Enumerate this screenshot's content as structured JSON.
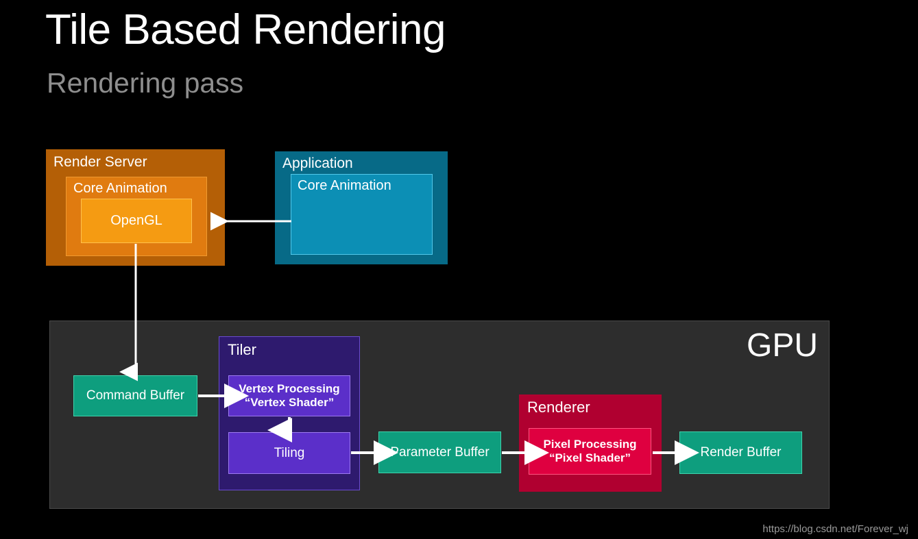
{
  "slide": {
    "title": "Tile Based Rendering",
    "subtitle": "Rendering pass",
    "background_color": "#000000",
    "watermark": "https://blog.csdn.net/Forever_wj"
  },
  "diagram": {
    "render_server": {
      "label": "Render Server",
      "color": "#b45f06",
      "core_animation": {
        "label": "Core Animation",
        "color": "#e07b10",
        "opengl": {
          "label": "OpenGL",
          "color": "#f59b12"
        }
      }
    },
    "application": {
      "label": "Application",
      "color": "#076a87",
      "core_animation": {
        "label": "Core Animation",
        "color": "#0c8fb5"
      }
    },
    "gpu": {
      "label": "GPU",
      "color": "#2d2d2d",
      "command_buffer": {
        "label": "Command Buffer",
        "color": "#0e9e7e"
      },
      "tiler": {
        "label": "Tiler",
        "color": "#2e1a6e",
        "vertex_processing": {
          "line1": "Vertex Processing",
          "line2": "“Vertex Shader”",
          "color": "#5b2fc9"
        },
        "tiling": {
          "label": "Tiling",
          "color": "#5b2fc9"
        }
      },
      "parameter_buffer": {
        "label": "Parameter Buffer",
        "color": "#0e9e7e"
      },
      "renderer": {
        "label": "Renderer",
        "color": "#b00030",
        "pixel_processing": {
          "line1": "Pixel Processing",
          "line2": "“Pixel Shader”",
          "color": "#df0040"
        }
      },
      "render_buffer": {
        "label": "Render Buffer",
        "color": "#0e9e7e"
      }
    },
    "arrow_color": "#ffffff"
  }
}
